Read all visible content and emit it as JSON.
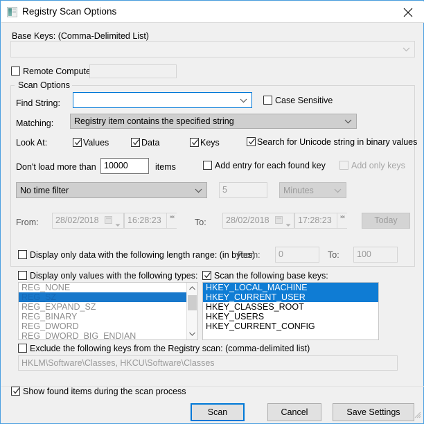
{
  "window": {
    "title": "Registry Scan Options",
    "icon": "registry-window-icon",
    "close_label": "✕",
    "accent_color": "#0078d7",
    "border_color": "#4a9fe0",
    "selection_color": "#0f7cd4",
    "background_color": "#f0f0f0"
  },
  "base_keys": {
    "label": "Base Keys:  (Comma-Delimited List)",
    "value": "",
    "placeholder": "",
    "enabled": false
  },
  "remote_computer": {
    "label": "Remote Computer:",
    "checked": false,
    "value": "",
    "enabled": false
  },
  "scan_options": {
    "group_title": "Scan Options",
    "find_string": {
      "label": "Find String:",
      "value": "",
      "focused": true
    },
    "case_sensitive": {
      "label": "Case Sensitive",
      "checked": false
    },
    "matching": {
      "label": "Matching:",
      "value": "Registry item contains the specified string"
    },
    "look_at": {
      "label": "Look At:",
      "values": {
        "label": "Values",
        "checked": true
      },
      "data": {
        "label": "Data",
        "checked": true
      },
      "keys": {
        "label": "Keys",
        "checked": true
      },
      "unicode": {
        "label": "Search for Unicode string in binary values",
        "checked": true
      }
    },
    "load_limit": {
      "label_before": "Don't load more than",
      "value": "10000",
      "label_after": "items"
    },
    "add_entry": {
      "label": "Add entry for each found key",
      "checked": false,
      "enabled": true
    },
    "add_only_keys": {
      "label": "Add only keys",
      "checked": false,
      "enabled": false
    },
    "time_filter": {
      "value": "No time filter",
      "amount": "5",
      "unit": "Minutes",
      "enabled": false
    },
    "date_range": {
      "from_label": "From:",
      "from_date": "28/02/2018",
      "from_time": "16:28:23",
      "to_label": "To:",
      "to_date": "28/02/2018",
      "to_time": "17:28:23",
      "today_button": "Today",
      "enabled": false
    },
    "length_range": {
      "label": "Display only data with the following length range: (in bytes)",
      "checked": false,
      "from_label": "From:",
      "from_value": "0",
      "to_label": "To:",
      "to_value": "100"
    },
    "value_types": {
      "label": "Display only values with the following types:",
      "checked": false,
      "enabled": false,
      "items": [
        {
          "text": "REG_NONE",
          "selected": false
        },
        {
          "text": "REG_SZ",
          "selected": true
        },
        {
          "text": "REG_EXPAND_SZ",
          "selected": false
        },
        {
          "text": "REG_BINARY",
          "selected": false
        },
        {
          "text": "REG_DWORD",
          "selected": false
        },
        {
          "text": "REG_DWORD_BIG_ENDIAN",
          "selected": false
        }
      ]
    },
    "base_key_scan": {
      "label": "Scan the following base keys:",
      "checked": true,
      "enabled": true,
      "items": [
        {
          "text": "HKEY_LOCAL_MACHINE",
          "selected": true
        },
        {
          "text": "HKEY_CURRENT_USER",
          "selected": true
        },
        {
          "text": "HKEY_CLASSES_ROOT",
          "selected": false
        },
        {
          "text": "HKEY_USERS",
          "selected": false
        },
        {
          "text": "HKEY_CURRENT_CONFIG",
          "selected": false
        }
      ]
    },
    "exclude_keys": {
      "label": "Exclude the following keys from the Registry scan: (comma-delimited list)",
      "checked": false,
      "value": "HKLM\\Software\\Classes, HKCU\\Software\\Classes",
      "enabled": false
    }
  },
  "show_found_items": {
    "label": "Show found items during the scan process",
    "checked": true
  },
  "buttons": {
    "scan": "Scan",
    "cancel": "Cancel",
    "save_settings": "Save Settings"
  }
}
